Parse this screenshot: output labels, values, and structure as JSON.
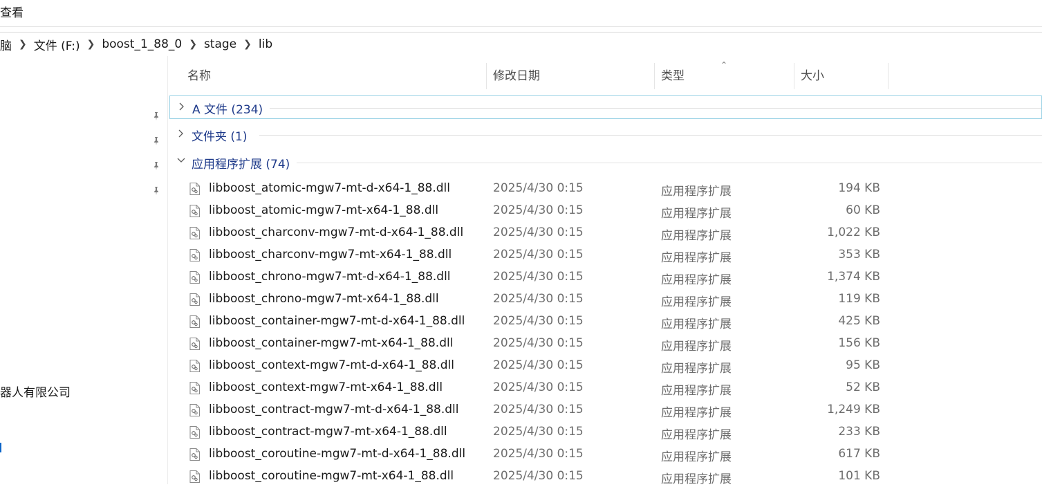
{
  "ribbon": {
    "tab_view": "查看"
  },
  "address": {
    "crumbs": [
      "脑",
      "文件 (F:)",
      "boost_1_88_0",
      "stage",
      "lib"
    ]
  },
  "nav": {
    "company": "器人有限公司"
  },
  "columns": {
    "name": "名称",
    "date": "修改日期",
    "type": "类型",
    "size": "大小"
  },
  "groups": [
    {
      "label": "A 文件 (234)",
      "expanded": false
    },
    {
      "label": "文件夹 (1)",
      "expanded": false
    },
    {
      "label": "应用程序扩展 (74)",
      "expanded": true
    }
  ],
  "files": [
    {
      "name": "libboost_atomic-mgw7-mt-d-x64-1_88.dll",
      "date": "2025/4/30 0:15",
      "type": "应用程序扩展",
      "size": "194 KB"
    },
    {
      "name": "libboost_atomic-mgw7-mt-x64-1_88.dll",
      "date": "2025/4/30 0:15",
      "type": "应用程序扩展",
      "size": "60 KB"
    },
    {
      "name": "libboost_charconv-mgw7-mt-d-x64-1_88.dll",
      "date": "2025/4/30 0:15",
      "type": "应用程序扩展",
      "size": "1,022 KB"
    },
    {
      "name": "libboost_charconv-mgw7-mt-x64-1_88.dll",
      "date": "2025/4/30 0:15",
      "type": "应用程序扩展",
      "size": "353 KB"
    },
    {
      "name": "libboost_chrono-mgw7-mt-d-x64-1_88.dll",
      "date": "2025/4/30 0:15",
      "type": "应用程序扩展",
      "size": "1,374 KB"
    },
    {
      "name": "libboost_chrono-mgw7-mt-x64-1_88.dll",
      "date": "2025/4/30 0:15",
      "type": "应用程序扩展",
      "size": "119 KB"
    },
    {
      "name": "libboost_container-mgw7-mt-d-x64-1_88.dll",
      "date": "2025/4/30 0:15",
      "type": "应用程序扩展",
      "size": "425 KB"
    },
    {
      "name": "libboost_container-mgw7-mt-x64-1_88.dll",
      "date": "2025/4/30 0:15",
      "type": "应用程序扩展",
      "size": "156 KB"
    },
    {
      "name": "libboost_context-mgw7-mt-d-x64-1_88.dll",
      "date": "2025/4/30 0:15",
      "type": "应用程序扩展",
      "size": "95 KB"
    },
    {
      "name": "libboost_context-mgw7-mt-x64-1_88.dll",
      "date": "2025/4/30 0:15",
      "type": "应用程序扩展",
      "size": "52 KB"
    },
    {
      "name": "libboost_contract-mgw7-mt-d-x64-1_88.dll",
      "date": "2025/4/30 0:15",
      "type": "应用程序扩展",
      "size": "1,249 KB"
    },
    {
      "name": "libboost_contract-mgw7-mt-x64-1_88.dll",
      "date": "2025/4/30 0:15",
      "type": "应用程序扩展",
      "size": "233 KB"
    },
    {
      "name": "libboost_coroutine-mgw7-mt-d-x64-1_88.dll",
      "date": "2025/4/30 0:15",
      "type": "应用程序扩展",
      "size": "617 KB"
    },
    {
      "name": "libboost_coroutine-mgw7-mt-x64-1_88.dll",
      "date": "2025/4/30 0:15",
      "type": "应用程序扩展",
      "size": "101 KB"
    }
  ],
  "icons": {
    "pin": "pin-icon",
    "file": "dll-file-icon",
    "chevron_right": "chevron-right-icon",
    "chevron_down": "chevron-down-icon",
    "breadcrumb_sep": "chevron-right-icon"
  },
  "colors": {
    "group_label": "#1e3a8a",
    "focus_border": "#9cd3e6",
    "accent": "#0a64c8"
  }
}
